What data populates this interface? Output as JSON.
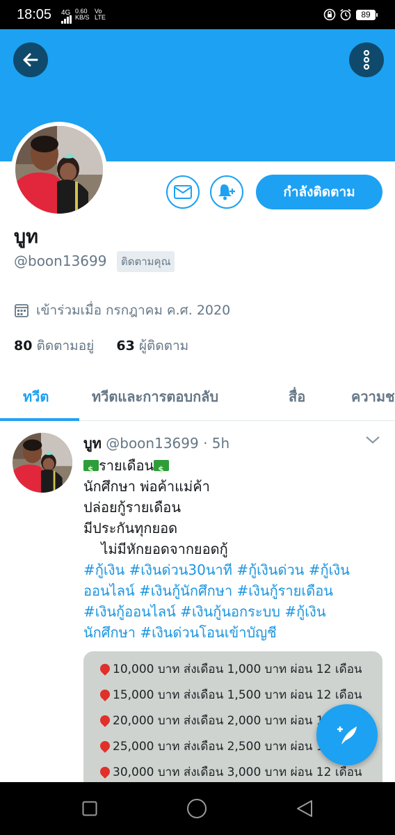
{
  "status_bar": {
    "time": "18:05",
    "network": "4G",
    "speed_value": "0.60",
    "speed_unit": "KB/S",
    "volte_top": "Vo",
    "volte_bottom": "LTE",
    "battery": "89"
  },
  "profile": {
    "name": "บูท",
    "handle": "@boon13699",
    "follows_you": "ติดตามคุณ",
    "joined": "เข้าร่วมเมื่อ กรกฎาคม ค.ศ. 2020",
    "following_count": "80",
    "following_label": "ติดตามอยู่",
    "followers_count": "63",
    "followers_label": "ผู้ติดตาม",
    "follow_button": "กำลังติดตาม"
  },
  "tabs": [
    {
      "label": "ทวีต"
    },
    {
      "label": "ทวีตและการตอบกลับ"
    },
    {
      "label": "สื่อ"
    },
    {
      "label": "ความช"
    }
  ],
  "tweet": {
    "name": "บูท",
    "handle": "@boon13699",
    "time": "· 5h",
    "title": "รายเดือน",
    "line2": "นักศึกษา  พ่อค้าแม่ค้า",
    "line3": "ปล่อยกู้รายเดือน",
    "line4": "มีประกันทุกยอด",
    "line5": "    ไม่มีหักยอดจากยอดกู้",
    "hashtags": [
      "#กู้เงิน #เงินด่วน30นาที #กู้เงินด่วน #กู้เงิน",
      "ออนไลน์ #เงินกู้นักศึกษา #เงินกู้รายเดือน",
      "#เงินกู้ออนไลน์ #เงินกู้นอกระบบ #กู้เงิน",
      "นักศึกษา #เงินด่วนโอนเข้าบัญชี"
    ],
    "media_rows": [
      "10,000 บาท ส่งเดือน 1,000 บาท ผ่อน 12 เดือน",
      "15,000 บาท ส่งเดือน 1,500 บาท ผ่อน 12 เดือน",
      "20,000 บาท ส่งเดือน 2,000 บาท ผ่อน 12 เดือน",
      "25,000 บาท ส่งเดือน 2,500 บาท ผ่อน 12 เดือน",
      "30,000 บาท ส่งเดือน 3,000 บาท ผ่อน 12 เดือน"
    ]
  }
}
